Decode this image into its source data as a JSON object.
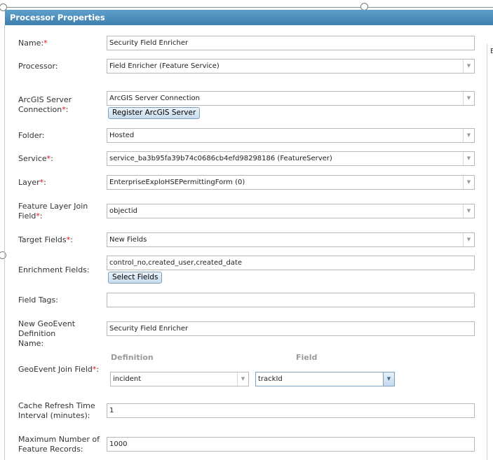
{
  "dialog": {
    "title": "Processor Properties"
  },
  "side_panel": {
    "letter": "E"
  },
  "form": {
    "name": {
      "label": "Name:",
      "required": "*",
      "value": "Security Field Enricher"
    },
    "processor": {
      "label": "Processor:",
      "value": "Field Enricher (Feature Service)"
    },
    "server_connection": {
      "label_line1": "ArcGIS Server",
      "label_line2": "Connection",
      "required": "*",
      "label_suffix": ":",
      "value": "ArcGIS Server Connection",
      "button": "Register ArcGIS Server"
    },
    "folder": {
      "label": "Folder:",
      "value": "Hosted"
    },
    "service": {
      "label": "Service",
      "required": "*",
      "label_suffix": ":",
      "value": "service_ba3b95fa39b74c0686cb4efd98298186 (FeatureServer)"
    },
    "layer": {
      "label": "Layer",
      "required": "*",
      "label_suffix": ":",
      "value": "EnterpriseExploHSEPermittingForm (0)"
    },
    "join_field": {
      "label_line1": "Feature Layer Join",
      "label_line2": "Field",
      "required": "*",
      "label_suffix": ":",
      "value": "objectid"
    },
    "target_fields": {
      "label": "Target Fields",
      "required": "*",
      "label_suffix": ":",
      "value": "New Fields"
    },
    "enrichment_fields": {
      "label": "Enrichment Fields:",
      "value": "control_no,created_user,created_date",
      "button": "Select Fields"
    },
    "field_tags": {
      "label": "Field Tags:",
      "value": ""
    },
    "geoevent_def_name": {
      "label_line1": "New GeoEvent Definition",
      "label_line2": "Name:",
      "value": "Security Field Enricher"
    },
    "geoevent_join": {
      "label": "GeoEvent Join Field",
      "required": "*",
      "label_suffix": ":",
      "definition_header": "Definition",
      "field_header": "Field",
      "definition_value": "incident",
      "field_value": "trackId"
    },
    "cache_refresh": {
      "label_line1": "Cache Refresh Time",
      "label_line2": "Interval (minutes):",
      "value": "1"
    },
    "max_records": {
      "label_line1": "Maximum Number of",
      "label_line2": "Feature Records:",
      "value": "1000"
    }
  },
  "icons": {
    "dropdown": "chevron-down-icon",
    "resize_handle": "resize-handle"
  },
  "colors": {
    "titlebar": "#4a8bbb",
    "required": "#e0101a",
    "button": "#d6e6f4"
  }
}
